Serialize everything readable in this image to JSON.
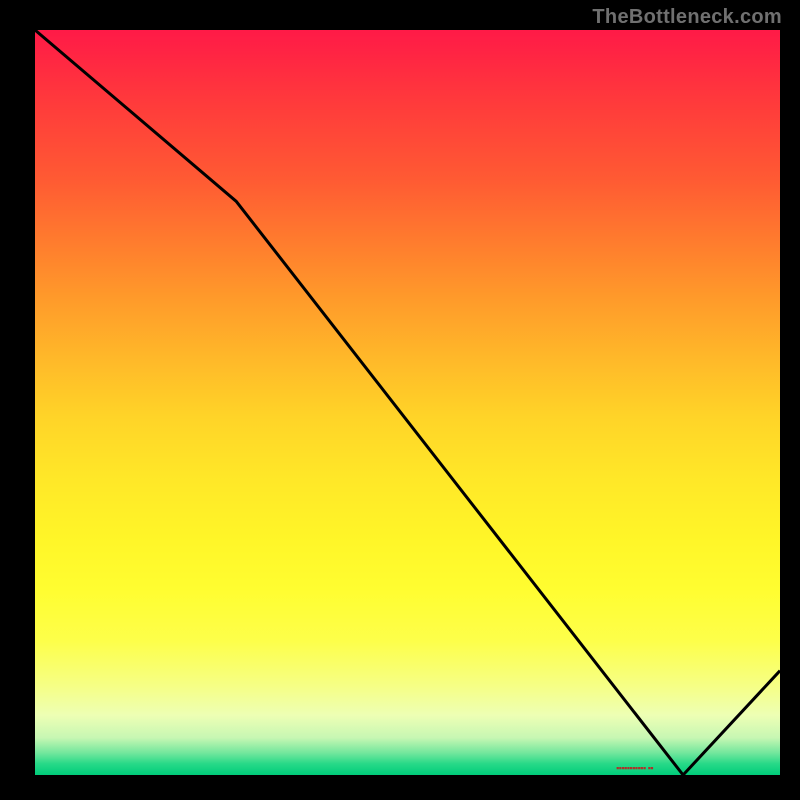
{
  "attribution": "TheBottleneck.com",
  "chart_data": {
    "type": "line",
    "title": "",
    "xlabel": "",
    "ylabel": "",
    "x": [
      0,
      0.27,
      0.87,
      1.0
    ],
    "values": [
      1.0,
      0.77,
      0.0,
      0.14
    ],
    "ylim": [
      0,
      1
    ],
    "xlim": [
      0,
      1
    ],
    "marker_region": {
      "start_x": 0.78,
      "end_x": 0.88,
      "y": 0.0
    },
    "background_gradient": "red-yellow-green vertical",
    "grid": false
  },
  "marker_label": "▪▪▪▪▪▪▪▪▪▪▪ ▪▪"
}
